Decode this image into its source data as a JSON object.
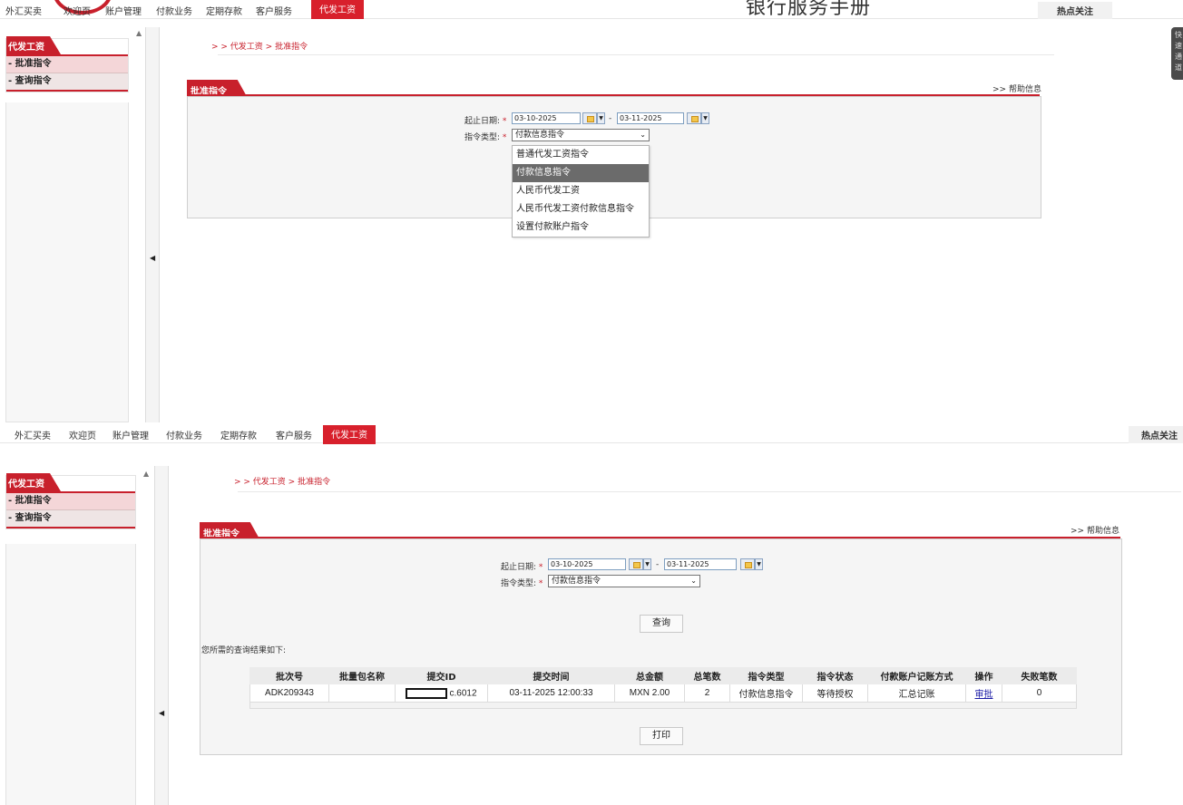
{
  "nav": {
    "items": [
      "外汇买卖",
      "欢迎页",
      "账户管理",
      "付款业务",
      "定期存款",
      "客户服务",
      "代发工资"
    ],
    "active": "代发工资",
    "hot": "热点关注"
  },
  "header_title": "银行服务手册",
  "right_tab": [
    "快",
    "速",
    "通",
    "道"
  ],
  "sidebar": {
    "title": "代发工资",
    "items": [
      "- 批准指令",
      "- 查询指令"
    ]
  },
  "breadcrumb": "> > 代发工资 > 批准指令",
  "panel": {
    "title": "批准指令",
    "help": ">> 帮助信息"
  },
  "form": {
    "date_label": "起止日期:",
    "required_mark": "*",
    "start_date": "03-10-2025",
    "end_date": "03-11-2025",
    "range_sep": "-",
    "type_label": "指令类型:",
    "type_selected": "付款信息指令",
    "type_options": [
      "普通代发工资指令",
      "付款信息指令",
      "人民币代发工资",
      "人民币代发工资付款信息指令",
      "设置付款账户指令"
    ],
    "query_button": "查询",
    "print_button": "打印"
  },
  "results": {
    "caption": "您所需的查询结果如下:",
    "columns": [
      "批次号",
      "批量包名称",
      "提交ID",
      "提交时间",
      "总金额",
      "总笔数",
      "指令类型",
      "指令状态",
      "付款账户记账方式",
      "操作",
      "失败笔数"
    ],
    "rows": [
      {
        "batch_no": "ADK209343",
        "package_name": "",
        "submit_id": "c.6012",
        "submit_time": "03-11-2025 12:00:33",
        "total_amount": "MXN 2.00",
        "total_count": "2",
        "instruction_type": "付款信息指令",
        "status": "等待授权",
        "accounting_method": "汇总记账",
        "action": "审批",
        "failed_count": "0"
      }
    ]
  },
  "colors": {
    "brand_red": "#c8202c",
    "link_blue": "#1a1aa6"
  }
}
